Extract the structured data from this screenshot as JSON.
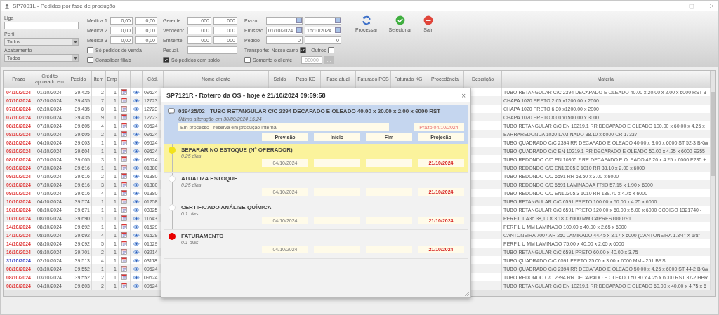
{
  "window": {
    "title": "SP7001L - Pedidos por fase de produção"
  },
  "filters": {
    "liga": {
      "label": "Liga"
    },
    "perfil": {
      "label": "Perfil",
      "value": "Todos"
    },
    "acabamento": {
      "label": "Acabamento",
      "value": "Todos"
    },
    "ranges": [
      {
        "label": "Medida 1",
        "from": "0,00",
        "to": "0,00"
      },
      {
        "label": "Medida 2",
        "from": "0,00",
        "to": "0,00"
      },
      {
        "label": "Medida 3",
        "from": "0,00",
        "to": "0,00"
      }
    ],
    "people": [
      {
        "label": "Gerente",
        "from": "000",
        "to": "000"
      },
      {
        "label": "Vendedor",
        "from": "000",
        "to": "000"
      },
      {
        "label": "Emitente",
        "from": "000",
        "to": "000"
      }
    ],
    "dates": [
      {
        "label": "Prazo",
        "kind": "date"
      },
      {
        "label": "Emissão",
        "kind": "date",
        "from": "01/10/2024",
        "to": "16/10/2024"
      },
      {
        "label": "Pedido",
        "kind": "number",
        "from": "0",
        "to": "0"
      }
    ],
    "checks": [
      {
        "label": "Só pedidos de venda",
        "checked": false
      },
      {
        "label": "Consolidar filiais",
        "checked": false
      }
    ],
    "ped_cli": {
      "label": "Ped.cli."
    },
    "saldo_check": {
      "label": "Só pedidos com saldo",
      "checked": true
    },
    "transporte": {
      "label": "Transporte:",
      "options": [
        {
          "label": "Nosso carro",
          "checked": true
        },
        {
          "label": "Outros",
          "checked": false
        }
      ]
    },
    "cliente": {
      "label": "Somente o cliente",
      "checked": false,
      "placeholder": "00000",
      "button": "..."
    }
  },
  "toolbar": [
    {
      "label": "Processar",
      "kind": "refresh"
    },
    {
      "label": "Selecionar",
      "kind": "confirm"
    },
    {
      "label": "Sair",
      "kind": "exit"
    }
  ],
  "table": {
    "columns": [
      "Prazo",
      "Crédito aprovado em",
      "Pedido",
      "Item",
      "Emp",
      "Cód.",
      "Nome cliente",
      "Saldo",
      "Peso KG",
      "Fase atual",
      "Faturado PCS",
      "Faturado KG",
      "Procedência",
      "Descrição",
      "Material"
    ],
    "rows": [
      {
        "prazo": "04/10/2024",
        "color": "#e03a3a",
        "credito": "01/10/2024",
        "pedido": "39.425",
        "item": "2",
        "emp": "1",
        "cod": "09524",
        "material": "TUBO RETANGULAR C/C 2394 DECAPADO E OLEADO 40.00 x 20.00 x 2.00 x 6000 RST 3"
      },
      {
        "prazo": "07/10/2024",
        "color": "#e03a3a",
        "credito": "02/10/2024",
        "pedido": "39.435",
        "item": "7",
        "emp": "1",
        "cod": "12723",
        "material": "CHAPA 1020 PRETO 2.65 x1200.00 x 2000"
      },
      {
        "prazo": "07/10/2024",
        "color": "#e03a3a",
        "credito": "02/10/2024",
        "pedido": "39.435",
        "item": "8",
        "emp": "1",
        "cod": "12723",
        "material": "CHAPA 1020 PRETO 6.30 x1200.00 x 2000"
      },
      {
        "prazo": "07/10/2024",
        "color": "#e03a3a",
        "credito": "02/10/2024",
        "pedido": "39.435",
        "item": "9",
        "emp": "1",
        "cod": "12723",
        "material": "CHAPA 1020 PRETO 8.00 x1500.00 x 3000"
      },
      {
        "prazo": "08/10/2024",
        "color": "#e03a3a",
        "credito": "07/10/2024",
        "pedido": "39.605",
        "item": "4",
        "emp": "1",
        "cod": "09524",
        "material": "TUBO RETANGULAR C/C EN 10219.1 RR DECAPADO E OLEADO 100.00 x 60.00 x 4.25 x"
      },
      {
        "prazo": "08/10/2024",
        "color": "#e03a3a",
        "credito": "07/10/2024",
        "pedido": "39.605",
        "item": "2",
        "emp": "1",
        "cod": "09524",
        "material": "BARRAREDONDA 1020 LAMINADO 38.10 x 6000 CR 17337"
      },
      {
        "prazo": "08/10/2024",
        "color": "#e03a3a",
        "credito": "04/10/2024",
        "pedido": "39.603",
        "item": "1",
        "emp": "1",
        "cod": "09524",
        "material": "TUBO QUADRADO C/C 2394 RR DECAPADO E OLEADO 40.00 x 3.00 x 6000 ST 52-3 BKW"
      },
      {
        "prazo": "08/10/2024",
        "color": "#e03a3a",
        "credito": "04/10/2024",
        "pedido": "39.604",
        "item": "1",
        "emp": "1",
        "cod": "09524",
        "material": "TUBO QUADRADO C/C EN 10219.1 RR DECAPADO E OLEADO 50.00 x 4.25 x 6000 S355"
      },
      {
        "prazo": "08/10/2024",
        "color": "#e03a3a",
        "credito": "07/10/2024",
        "pedido": "39.605",
        "item": "3",
        "emp": "1",
        "cod": "09524",
        "material": "TUBO REDONDO C/C EN 10305.2 RR DECAPADO E OLEADO 42.20 x 4.25 x 6000 E235 +"
      },
      {
        "prazo": "09/10/2024",
        "color": "#e03a3a",
        "credito": "07/10/2024",
        "pedido": "39.616",
        "item": "1",
        "emp": "1",
        "cod": "01380",
        "material": "TUBO REDONDO C/C EN10305.3 1010 RR 38.10 x 2.00 x 6000"
      },
      {
        "prazo": "09/10/2024",
        "color": "#e03a3a",
        "credito": "07/10/2024",
        "pedido": "39.616",
        "item": "2",
        "emp": "1",
        "cod": "01380",
        "material": "TUBO REDONDO C/C 6591 RR 63.50 x 3.00 x 6000"
      },
      {
        "prazo": "09/10/2024",
        "color": "#e03a3a",
        "credito": "07/10/2024",
        "pedido": "39.616",
        "item": "3",
        "emp": "1",
        "cod": "01380",
        "material": "TUBO REDONDO C/C 6591 LAMINADAA FRIO 57.15 x 1.90 x 6000"
      },
      {
        "prazo": "09/10/2024",
        "color": "#e03a3a",
        "credito": "07/10/2024",
        "pedido": "39.616",
        "item": "4",
        "emp": "1",
        "cod": "01380",
        "material": "TUBO REDONDO C/C EN10305.3 1010 RR 139.70 x 4.75 x 6000"
      },
      {
        "prazo": "10/10/2024",
        "color": "#e03a3a",
        "credito": "04/10/2024",
        "pedido": "39.574",
        "item": "1",
        "emp": "1",
        "cod": "01258",
        "material": "TUBO RETANGULAR C/C 6591 PRETO 100.00 x 50.00 x 4.25 x 6000"
      },
      {
        "prazo": "10/10/2024",
        "color": "#e03a3a",
        "credito": "08/10/2024",
        "pedido": "39.671",
        "item": "1",
        "emp": "1",
        "cod": "03325",
        "material": "TUBO RETANGULAR C/C 6591 PRETO 120.00 x 60.00 x 5.00 x 6000 CODIGO 1321740 -"
      },
      {
        "prazo": "10/10/2024",
        "color": "#e03a3a",
        "credito": "08/10/2024",
        "pedido": "39.690",
        "item": "1",
        "emp": "1",
        "cod": "11643",
        "material": "PERFIL T A36 38,10 X 3,18 X 6000 MM CAPREST000791"
      },
      {
        "prazo": "14/10/2024",
        "color": "#e03a3a",
        "credito": "08/10/2024",
        "pedido": "39.692",
        "item": "1",
        "emp": "1",
        "cod": "01529",
        "material": "PERFIL U MM LAMINADO 100.00 x 40.00 x 2.65 x 6000"
      },
      {
        "prazo": "14/10/2024",
        "color": "#e03a3a",
        "credito": "08/10/2024",
        "pedido": "39.692",
        "item": "4",
        "emp": "1",
        "cod": "01529",
        "material": "CANTONEIRA 7007 AR 250 LAMINADO 44.45 x 3.17 x 6000 (CANTONEIRA 1.3/4\" X 1/8\""
      },
      {
        "prazo": "14/10/2024",
        "color": "#e03a3a",
        "credito": "08/10/2024",
        "pedido": "39.692",
        "item": "5",
        "emp": "1",
        "cod": "01529",
        "material": "PERFIL U MM LAMINADO 75.00 x 40.00 x 2.65 x 6000"
      },
      {
        "prazo": "16/10/2024",
        "color": "#e03a3a",
        "credito": "08/10/2024",
        "pedido": "39.701",
        "item": "2",
        "emp": "1",
        "cod": "03214",
        "material": "TUBO RETANGULAR C/C 6591 PRETO 60.00 x 40.00 x 3.75"
      },
      {
        "prazo": "31/10/2024",
        "color": "#3a46c8",
        "credito": "02/10/2024",
        "pedido": "39.513",
        "item": "4",
        "emp": "1",
        "cod": "03118",
        "material": "TUBO QUADRADO C/C 6591 PRETO 25.00 x 3.00 x 6000 MM - 251 BRS"
      },
      {
        "prazo": "08/10/2024",
        "color": "#e03a3a",
        "credito": "03/10/2024",
        "pedido": "39.552",
        "item": "1",
        "emp": "1",
        "cod": "09524",
        "material": "TUBO QUADRADO C/C 2394 RR DECAPADO E OLEADO 50.00 x 4.25 x 6000 ST 44-2 BKW"
      },
      {
        "prazo": "08/10/2024",
        "color": "#e03a3a",
        "credito": "03/10/2024",
        "pedido": "39.552",
        "item": "2",
        "emp": "1",
        "cod": "09524",
        "material": "TUBO REDONDO C/C 2394 RR DECAPADO E OLEADO 50.80 x 4.25 x 6000 RST 37-2 HBR"
      },
      {
        "prazo": "08/10/2024",
        "color": "#e03a3a",
        "credito": "04/10/2024",
        "pedido": "39.603",
        "item": "2",
        "emp": "1",
        "cod": "09524",
        "material": "TUBO RETANGULAR C/C EN 10219.1 RR DECAPADO E OLEADO 60.00 x 40.00 x 4.75 x 6"
      }
    ]
  },
  "dialog": {
    "title": "SP7121R - Roteiro da OS - hoje é 21/10/2024 09:59:58",
    "close": "×",
    "order": "039425/02 - TUBO RETANGULAR C/C 2394 DECAPADO E OLEADO 40.00 x 20.00 x 2.00 x 6000 RST",
    "updated": "Última alteração em 30/09/2024 15:24",
    "status": "Em processo - reserva em produção interna",
    "prazo": "Prazo 04/10/2024",
    "columns": [
      "Previsão",
      "Início",
      "Fim",
      "Projeção"
    ],
    "steps": [
      {
        "name": "SEPARAR NO ESTOQUE (Nº OPERADOR)",
        "duration": "0.25 dias",
        "previsao": "04/10/2024",
        "projecao": "21/10/2024",
        "selected": true,
        "color": "#f2e21c"
      },
      {
        "name": "ATUALIZA ESTOQUE",
        "duration": "0.25 dias",
        "previsao": "04/10/2024",
        "projecao": "21/10/2024",
        "selected": false,
        "color": "#ffffff"
      },
      {
        "name": "CERTIFICADO ANÁLISE QUÍMICA",
        "duration": "0.1 dias",
        "previsao": "04/10/2024",
        "projecao": "21/10/2024",
        "selected": false,
        "color": "#ffffff"
      },
      {
        "name": "FATURAMENTO",
        "duration": "0.1 dias",
        "previsao": "04/10/2024",
        "projecao": "21/10/2024",
        "selected": false,
        "color": "#e80000"
      }
    ]
  }
}
